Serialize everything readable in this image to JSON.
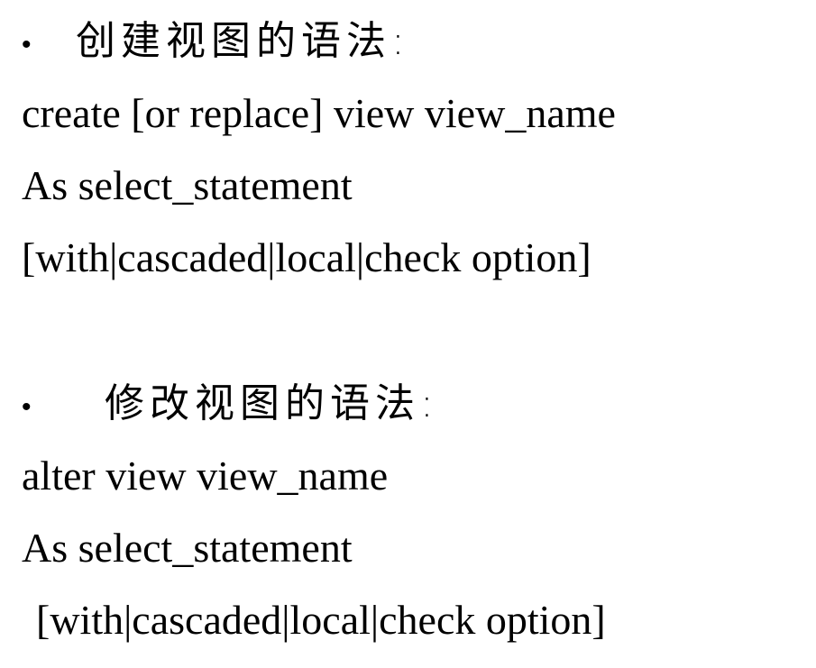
{
  "sections": [
    {
      "bullet": "•",
      "heading": "创建视图的语法:",
      "lines": [
        "create [or replace] view view_name",
        "As select_statement",
        "[with|cascaded|local|check option]"
      ]
    },
    {
      "bullet": "•",
      "heading": "修改视图的语法:",
      "lines": [
        "alter view view_name",
        "As select_statement",
        "[with|cascaded|local|check option]"
      ]
    }
  ]
}
